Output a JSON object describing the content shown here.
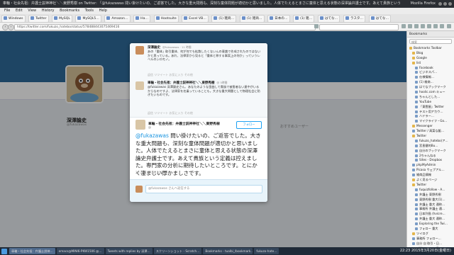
{
  "window": {
    "title": "車輪・社会先祖：弁護士説神神社＼＼東野秀樹 on Twitter: 「@fukazawas 問い掛けたいの、ご返答でした。大きな重大問題も、深刻な童体問題が適切かと思いました。人体でたえるとまさに童体と思える状態の深澤論弁護士です。あえて貴族という定義は控えました。専門家の分析に期待したいところです。とにかく凄まじい厚かましさです。」 - Mozilla Firefox",
    "app_name": "Mozilla Firefox"
  },
  "menu": [
    "File",
    "Edit",
    "View",
    "History",
    "Bookmarks",
    "Tools",
    "Help"
  ],
  "bookmarks_toolbar": [
    "Windows",
    "Twitter",
    "MySQL",
    "MySQL5…",
    "Amazon…",
    "Ha…",
    "Hootsuite",
    "Excel VB…",
    "(1) 雑商…",
    "(1) 雑商…",
    "日本の…",
    "(1) 雑…",
    "はてな…",
    "ラスタ…",
    "はてな…"
  ],
  "url": "https://twitter.com/fukuzo_hatebo/status/578488443075469416",
  "page": {
    "profile_name": "深澤論史",
    "profile_handle": "@fukazawas",
    "right_col_title": "おすすめユーザー"
  },
  "modal": {
    "replies": [
      {
        "name": "深澤論史",
        "handle": "@fukazawas · 11 時間",
        "text": "あの「重体」取引重体、何が何でも拡散したくないんの意識で作成されたのではないかと思っている。あれ、法律家から見ると「重体と称する事実上の何か」っていうレベルのシロモノ。",
        "actions": "返信 リツイート お気に入り その他"
      },
      {
        "name": "車輪・社会先祖：弁護士説神神社＼＼東野秀樹",
        "handle": "@ 5時間",
        "text": "@fukazawas 深澤論史さん、あなたのような歪曲して貴族で被害者ない連中がいるからなのですよ、法律家を名乗っていることも。大きな重大問題として物理社会に防ぎたいものです。",
        "actions": "返信 リツイート お気に入り その他"
      }
    ],
    "main_tweet": {
      "name": "車輪・社会先祖：弁護士説神神社＼＼東野秀樹",
      "handle": "@",
      "follow_label": "フォロー",
      "mention": "@fukazawas",
      "text": " 問い掛けたいの、ご返答でした。大きな重大問題も、深刻な童体問題が適切かと思いました。人体でたえるとまさに童体と思える状態の深澤論史弁護士です。あえて貴族という定義は控えました。専門家の分析に期待したいところです。とにかく凄まじい厚かましさです。",
      "meta": "20:22 - 2015年3月19日"
    },
    "compose_placeholder": "@fukazawas さんへ返信する"
  },
  "sidebar": {
    "header": "Bookmarks",
    "search_placeholder": "検索",
    "items": [
      {
        "label": "Bookmarks Toolbar",
        "level": 0,
        "folder": true
      },
      {
        "label": "Blog",
        "level": 1,
        "folder": true
      },
      {
        "label": "Google",
        "level": 1,
        "folder": true
      },
      {
        "label": "list",
        "level": 1,
        "folder": true
      },
      {
        "label": "Facebook",
        "level": 2,
        "folder": false
      },
      {
        "label": "ビジネスパ…",
        "level": 2,
        "folder": false
      },
      {
        "label": "仕様情報…",
        "level": 2,
        "folder": false
      },
      {
        "label": "(1) 雑商…",
        "level": 2,
        "folder": false
      },
      {
        "label": "はてなブックマーク",
        "level": 2,
        "folder": false
      },
      {
        "label": "hoolic.com キュー",
        "level": 2,
        "folder": false
      },
      {
        "label": "ちゃんとした…",
        "level": 2,
        "folder": false
      },
      {
        "label": "YouTube",
        "level": 2,
        "folder": false
      },
      {
        "label": "「東雲屋」Twitter",
        "level": 2,
        "folder": false
      },
      {
        "label": "テスト用アカウ…",
        "level": 2,
        "folder": false
      },
      {
        "label": "ハドラー…",
        "level": 2,
        "folder": false
      },
      {
        "label": "マイクライフ・Go…",
        "level": 2,
        "folder": false
      },
      {
        "label": "Messenger",
        "level": 1,
        "folder": true
      },
      {
        "label": "Twitter / 高菜な飯…",
        "level": 1,
        "folder": false
      },
      {
        "label": "Twitter",
        "level": 1,
        "folder": true
      },
      {
        "label": "fukuzo_hatebo(ア…",
        "level": 2,
        "folder": false
      },
      {
        "label": "宮島健的Bu…",
        "level": 2,
        "folder": false
      },
      {
        "label": "自分のブックマーク",
        "level": 2,
        "folder": false
      },
      {
        "label": "2ちゃんねる",
        "level": 2,
        "folder": false
      },
      {
        "label": "Sites - Dropbox",
        "level": 2,
        "folder": false
      },
      {
        "label": "phpMyAdmin",
        "level": 1,
        "folder": false
      },
      {
        "label": "Picasa ウェブアル…",
        "level": 1,
        "folder": false
      },
      {
        "label": "雑商品情報",
        "level": 1,
        "folder": false
      },
      {
        "label": "よく見るページ",
        "level": 1,
        "folder": true
      },
      {
        "label": "Twitter",
        "level": 1,
        "folder": true
      },
      {
        "label": "fuquizfollow - A…",
        "level": 2,
        "folder": false
      },
      {
        "label": "弁護士 東野秀樹",
        "level": 2,
        "folder": false
      },
      {
        "label": "東野秀樹 重大(1)…",
        "level": 2,
        "folder": false
      },
      {
        "label": "弁護士 重大 通称…",
        "level": 2,
        "folder": false
      },
      {
        "label": "事務所 弁護士 通…",
        "level": 2,
        "folder": false
      },
      {
        "label": "日本列島 (hvicre…",
        "level": 2,
        "folder": false
      },
      {
        "label": "弁護士 重大 通称…",
        "level": 2,
        "folder": false
      },
      {
        "label": "Exploring the Twi…",
        "level": 2,
        "folder": false
      },
      {
        "label": "フォロー 重大",
        "level": 2,
        "folder": false
      },
      {
        "label": "ツイログ",
        "level": 1,
        "folder": true
      },
      {
        "label": "事務所 フォロー…",
        "level": 1,
        "folder": false
      },
      {
        "label": "自分 自 取引・日…",
        "level": 1,
        "folder": false
      },
      {
        "label": "wiki ワイワイ 日…",
        "level": 1,
        "folder": false
      },
      {
        "label": "Hironoエロ(マイ…",
        "level": 1,
        "folder": false
      },
      {
        "label": "Bookmarks Menu",
        "level": 0,
        "folder": true
      },
      {
        "label": "Unsorted Bookmarks",
        "level": 0,
        "folder": true
      }
    ]
  },
  "taskbar": {
    "tasks": [
      "車輪・社会先祖：弁護士説神…",
      "emacs@MINI6-PKW1506 @…",
      "Tweets with replies by 深澤…",
      "スクリーンショット - Scratch…",
      "Bookmarks - tualbi_/bookmark…",
      "fukuzo-hate…"
    ],
    "clock": "22:23",
    "date": "2015年3月20日(金曜日)"
  }
}
